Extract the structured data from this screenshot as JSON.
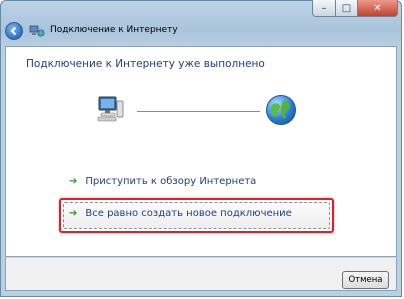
{
  "window": {
    "title": "Подключение к Интернету",
    "controls": {
      "minimize": "–",
      "maximize": "□",
      "close": "✕"
    }
  },
  "content": {
    "heading": "Подключение к Интернету уже выполнено",
    "links": {
      "browse": "Приступить к обзору Интернета",
      "new_connection": "Все равно создать новое подключение"
    }
  },
  "buttons": {
    "cancel": "Отмена"
  },
  "icons": {
    "back": "back-arrow-icon",
    "connection": "network-connection-icon",
    "computer": "computer-icon",
    "globe": "internet-globe-icon",
    "link_arrow": "green-arrow-icon"
  },
  "colors": {
    "heading_text": "#1e3f87",
    "link_arrow": "#2f9a2f",
    "highlight_border": "#d8232a"
  }
}
